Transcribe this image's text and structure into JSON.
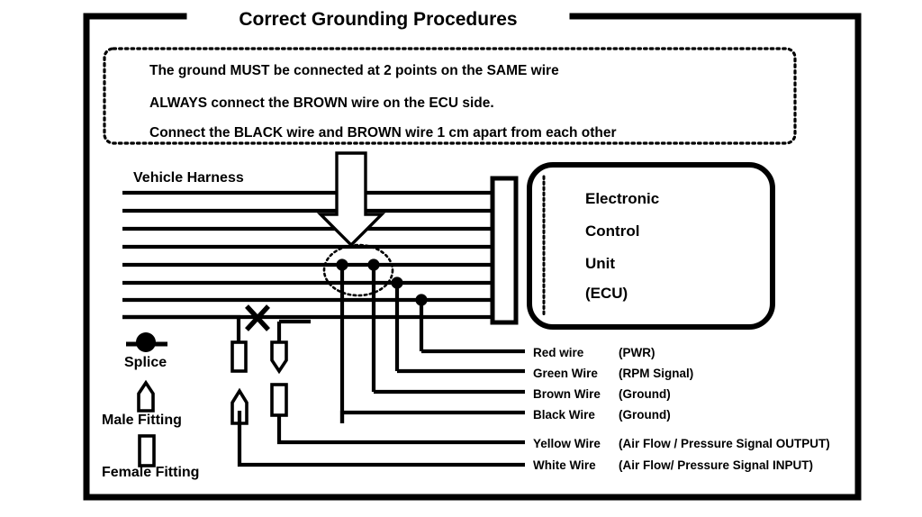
{
  "title": "Correct Grounding Procedures",
  "instructions": {
    "line1": "The ground MUST be connected at 2 points on the SAME wire",
    "line2": "ALWAYS connect the BROWN wire on the ECU side.",
    "line3": "Connect the BLACK wire and BROWN wire 1 cm apart from each other"
  },
  "harness_label": "Vehicle Harness",
  "ecu": {
    "line1": "Electronic",
    "line2": "Control",
    "line3": "Unit",
    "line4": "(ECU)"
  },
  "legend": {
    "splice": "Splice",
    "male_fitting": "Male Fitting",
    "female_fitting": "Female Fitting"
  },
  "wires": [
    {
      "name": "Red wire",
      "desc": "(PWR)"
    },
    {
      "name": "Green Wire",
      "desc": "(RPM Signal)"
    },
    {
      "name": "Brown Wire",
      "desc": "(Ground)"
    },
    {
      "name": "Black Wire",
      "desc": "(Ground)"
    },
    {
      "name": "Yellow Wire",
      "desc": "(Air Flow / Pressure Signal OUTPUT)"
    },
    {
      "name": "White Wire",
      "desc": "(Air Flow/ Pressure Signal INPUT)"
    }
  ],
  "colors": {
    "ink": "#000000",
    "paper": "#ffffff"
  }
}
